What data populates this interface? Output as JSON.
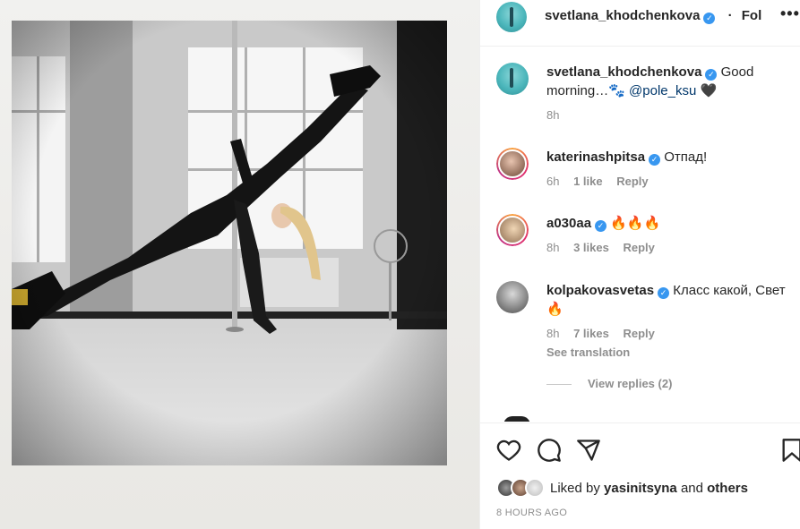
{
  "post": {
    "author": "svetlana_khodchenkova",
    "follow_label": "Fol",
    "more_label": "•••",
    "dot_separator": "·"
  },
  "caption": {
    "user": "svetlana_khodchenkova",
    "text": "Good morning…🐾",
    "mention": "@pole_ksu",
    "emoji": "🖤",
    "time": "8h"
  },
  "comments": [
    {
      "user": "katerinashpitsa",
      "text": "Отпад!",
      "time": "6h",
      "likes": "1 like",
      "reply": "Reply"
    },
    {
      "user": "a030aa",
      "text": "🔥🔥🔥",
      "time": "8h",
      "likes": "3 likes",
      "reply": "Reply"
    },
    {
      "user": "kolpakovasvetas",
      "text": "Класс какой, Свет🔥",
      "time": "8h",
      "likes": "7 likes",
      "reply": "Reply",
      "see_translation": "See translation"
    }
  ],
  "view_replies": "View replies (2)",
  "liked_by": {
    "prefix": "Liked by",
    "user": "yasinitsyna",
    "and": "and",
    "others": "others"
  },
  "timestamp": "8 HOURS AGO",
  "colors": {
    "verified": "#3897f0",
    "muted": "#8e8e8e",
    "link": "#00376b"
  },
  "icons": [
    "heart-icon",
    "comment-icon",
    "share-icon",
    "bookmark-icon",
    "more-icon",
    "verified-icon"
  ]
}
